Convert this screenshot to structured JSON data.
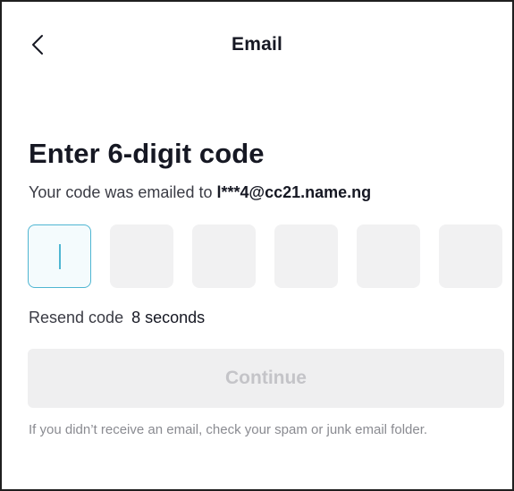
{
  "header": {
    "title": "Email",
    "back_icon": "chevron-left-icon"
  },
  "main": {
    "heading": "Enter 6-digit code",
    "subtext_prefix": "Your code was emailed to",
    "email": "l***4@cc21.name.ng",
    "code": {
      "length": 6,
      "digits": [
        "",
        "",
        "",
        "",
        "",
        ""
      ],
      "active_index": 0
    },
    "resend_label": "Resend code",
    "resend_timer": "8 seconds",
    "continue_label": "Continue",
    "help_text": "If you didn’t receive an email, check your spam or junk email folder."
  },
  "colors": {
    "accent": "#4fb6d2",
    "text_primary": "#161823",
    "text_secondary": "#8a8b91",
    "box_bg": "#f1f1f2",
    "button_disabled_bg": "#efeff0",
    "button_disabled_text": "#c4c4c8"
  }
}
